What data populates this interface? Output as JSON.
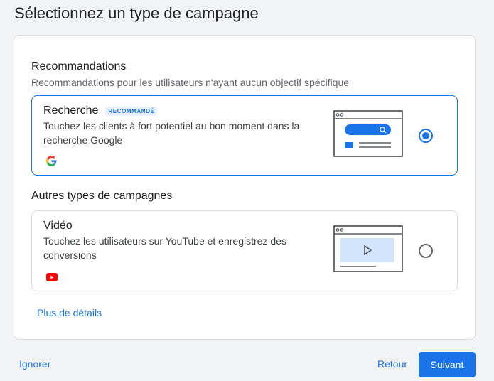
{
  "page_title": "Sélectionnez un type de campagne",
  "recommendations": {
    "title": "Recommandations",
    "subtitle": "Recommandations pour les utilisateurs n'ayant aucun objectif spécifique",
    "option": {
      "title": "Recherche",
      "badge": "RECOMMANDÉ",
      "description": "Touchez les clients à fort potentiel au bon moment dans la recherche Google",
      "logo_icon": "google-g-logo-icon",
      "selected": true
    }
  },
  "others": {
    "title": "Autres types de campagnes",
    "option": {
      "title": "Vidéo",
      "description": "Touchez les utilisateurs sur YouTube et enregistrez des conversions",
      "logo_icon": "youtube-logo-icon",
      "selected": false
    }
  },
  "more_details_link": "Plus de détails",
  "footer": {
    "skip_label": "Ignorer",
    "back_label": "Retour",
    "next_label": "Suivant"
  },
  "colors": {
    "accent": "#1a73e8",
    "illustration_fill": "#d2e3fc",
    "youtube_red": "#ff0000"
  }
}
